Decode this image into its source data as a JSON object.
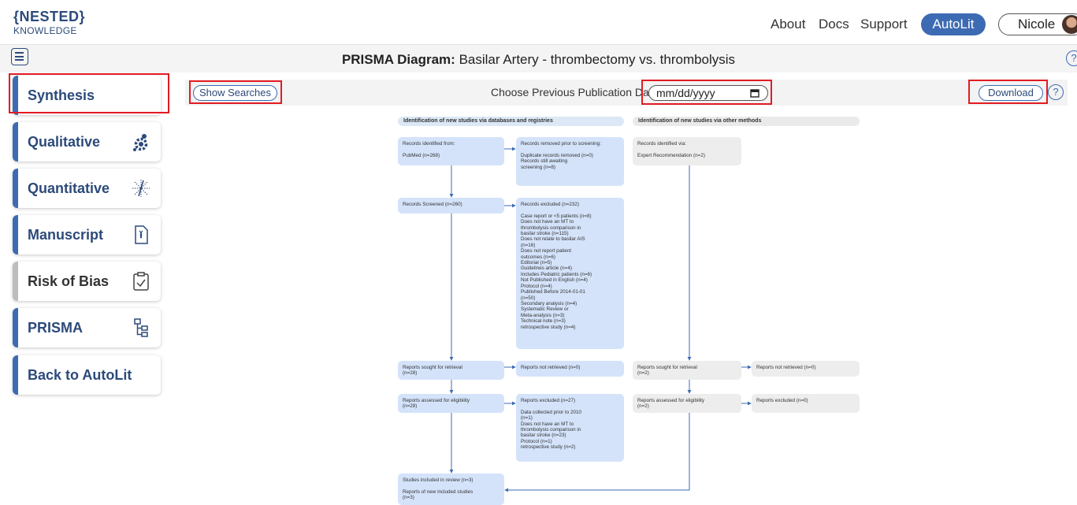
{
  "brand": {
    "line1": "{NESTED}",
    "line2": "KNOWLEDGE"
  },
  "nav": {
    "about": "About",
    "docs": "Docs",
    "support": "Support",
    "autolit": "AutoLit",
    "user": "Nicole"
  },
  "title": {
    "prefix": "PRISMA Diagram:",
    "name": "Basilar Artery - thrombectomy vs. thrombolysis"
  },
  "sidebar": [
    {
      "label": "Synthesis",
      "icon": "none"
    },
    {
      "label": "Qualitative",
      "icon": "gears-icon"
    },
    {
      "label": "Quantitative",
      "icon": "starburst-icon"
    },
    {
      "label": "Manuscript",
      "icon": "manuscript-icon"
    },
    {
      "label": "Risk of Bias",
      "icon": "clipboard-check-icon"
    },
    {
      "label": "PRISMA",
      "icon": "hierarchy-icon"
    },
    {
      "label": "Back to AutoLit",
      "icon": "none"
    }
  ],
  "toolbar": {
    "show_searches": "Show Searches",
    "date_label": "Choose Previous Publication Date",
    "date_placeholder": "mm/dd/yyyy",
    "download": "Download",
    "help": "?"
  },
  "colors": {
    "accent": "#3d6bb3",
    "highlight": "#e21b23",
    "box_blue": "#d4e3fa",
    "box_gray": "#ededed"
  },
  "prisma": {
    "header_left": "Identification of new studies via databases and registries",
    "header_right": "Identification of new studies via other methods",
    "id_records": "Records identified from:\n\n  PubMed (n=268)",
    "removed": "Records removed prior to screening:\n\n  Duplicate records removed (n=0)\n  Records still awaiting\n  screening (n=8)",
    "other_id": "Records identified via:\n\n  Expert Recommendation (n=2)",
    "screened": "Records Screened (n=260)",
    "excluded": "Records excluded (n=232)\n\n  Case report or <5 patients (n=8)\n  Does not have an MT to\n  thrombolysis comparison in\n  basilar stroke (n=115)\n  Does not relate to basilar AIS\n  (n=16)\n  Does not report patient\n  outcomes (n=6)\n  Editorial (n=5)\n  Guidelines article (n=4)\n  Includes Pediatric patients (n=6)\n  Not Published in English (n=4)\n  Protocol (n=4)\n  Published Before 2014-01-01\n  (n=50)\n  Secondary analysis (n=4)\n  Systematic Review or\n  Meta-analysis (n=3)\n  Technical note (n=3)\n  retrospective study (n=4)",
    "sought": "Reports sought for retrieval\n(n=28)",
    "not_retrieved": "Reports not retrieved (n=0)",
    "sought_other": "Reports sought for retrieval\n(n=2)",
    "not_retrieved_other": "Reports not retrieved (n=0)",
    "assessed": "Reports assessed for eligibility\n(n=28)",
    "reports_excluded": "Reports excluded (n=27)\n\n  Data collected prior to 2010\n  (n=1)\n  Does not have an MT to\n  thrombolysis comparison in\n  basilar stroke (n=23)\n  Protocol (n=1)\n  retrospective study (n=2)",
    "assessed_other": "Reports assessed for eligibility\n(n=2)",
    "reports_excluded_other": "Reports excluded (n=0)",
    "included": "Studies included in review (n=3)\n\nReports of new included studies\n(n=3)"
  }
}
